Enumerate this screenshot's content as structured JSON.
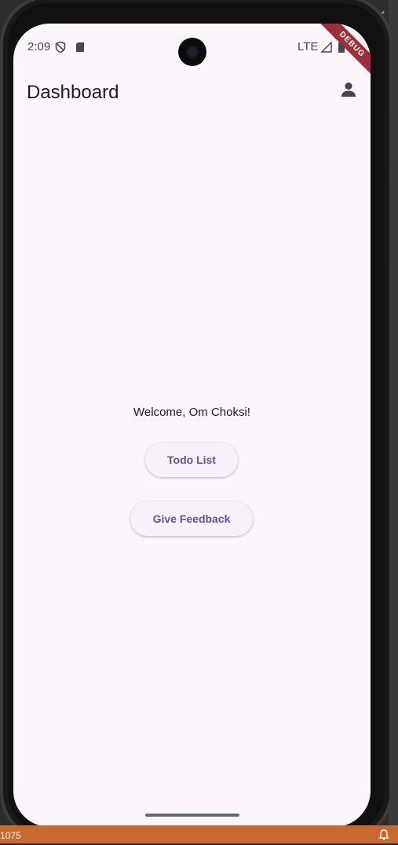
{
  "ide": {
    "close_glyph": "✕",
    "bottom_number": "1075"
  },
  "status_bar": {
    "time": "2:09",
    "network": "LTE",
    "debug_banner": "DEBUG"
  },
  "app_bar": {
    "title": "Dashboard",
    "profile_icon": "person-icon"
  },
  "main": {
    "welcome_text": "Welcome, Om Choksi!",
    "buttons": [
      {
        "label": "Todo List"
      },
      {
        "label": "Give Feedback"
      }
    ]
  },
  "colors": {
    "background": "#fcf6fc",
    "button_bg": "#f7f1fa",
    "button_text": "#65558f",
    "debug_ribbon": "#9b2f3a"
  }
}
